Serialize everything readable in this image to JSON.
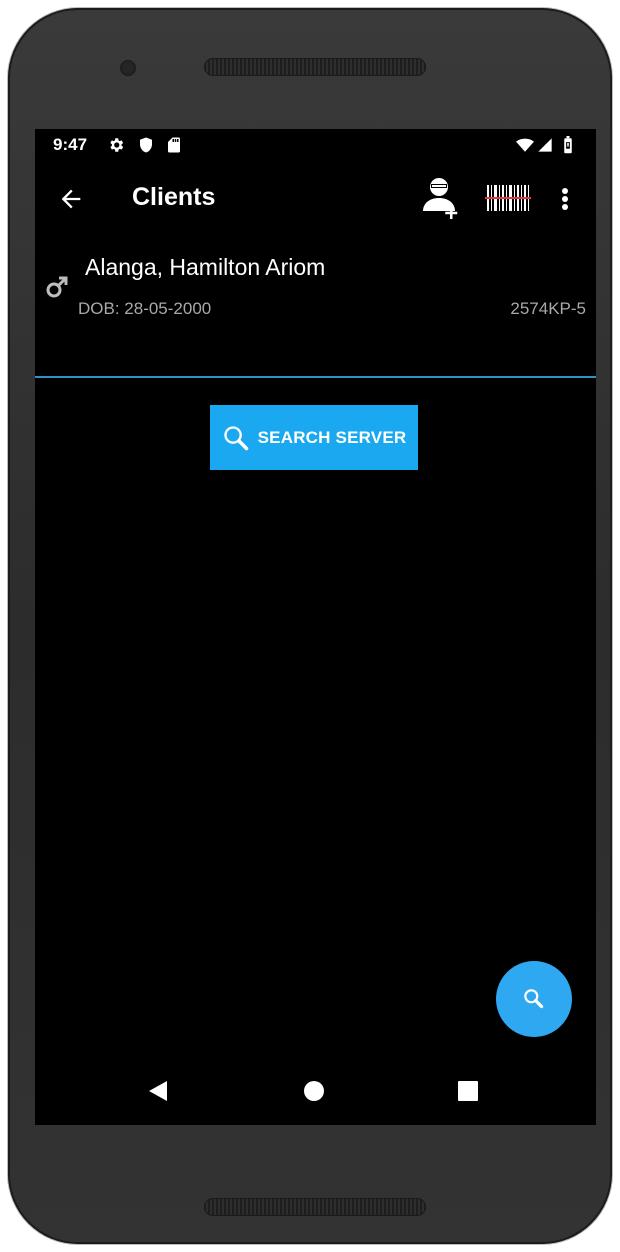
{
  "status_bar": {
    "time": "9:47",
    "left_icons": [
      "gear-icon",
      "shield-icon",
      "sd-card-icon"
    ],
    "right_icons": [
      "wifi-icon",
      "signal-icon",
      "battery-icon"
    ]
  },
  "app_bar": {
    "title": "Clients",
    "actions": [
      "add-client-icon",
      "barcode-scan-icon",
      "more-vert-icon"
    ]
  },
  "clients": [
    {
      "name": "Alanga, Hamilton Ariom",
      "dob": "DOB: 28-05-2000",
      "id": "2574KP-5",
      "gender_icon": "male-icon"
    }
  ],
  "search_server": {
    "label": "SEARCH SERVER",
    "icon": "search-icon"
  },
  "fab": {
    "icon": "search-icon"
  },
  "nav_bar": {
    "icons": [
      "nav-back-icon",
      "nav-home-icon",
      "nav-recents-icon"
    ]
  },
  "colors": {
    "accent": "#1aa9f0",
    "fab": "#2ea8f0",
    "divider": "#2c93c7",
    "background": "#000000",
    "secondary_text": "#a9a9a9"
  }
}
